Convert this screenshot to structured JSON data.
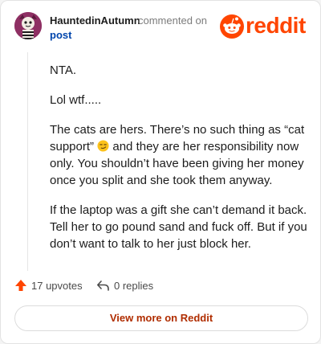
{
  "header": {
    "username": "HauntedinAutumn",
    "action_text": "commented on",
    "post_link_label": "post",
    "brand_word": "reddit"
  },
  "comment": {
    "paragraphs": [
      "NTA.",
      "Lol wtf.....",
      [
        "The cats are hers. There’s no such thing as “cat support” ",
        " and they are her responsibility now only. You shouldn’t have been giving her money once you split and she took them anyway."
      ],
      "If the laptop was a gift she can’t demand it back. Tell her to go pound sand and fuck off. But if you don’t want to talk to her just block her."
    ]
  },
  "actions": {
    "upvotes_label": "17 upvotes",
    "replies_label": "0 replies"
  },
  "cta": {
    "view_more_label": "View more on Reddit"
  },
  "colors": {
    "brand": "#ff4500",
    "link": "#0045ac",
    "cta_text": "#b02d00"
  },
  "icons": {
    "avatar": "avatar",
    "brand": "reddit-snoo-icon",
    "emoji": "smirk-emoji-icon",
    "upvote": "upvote-arrow-icon",
    "reply": "reply-arrow-icon"
  }
}
